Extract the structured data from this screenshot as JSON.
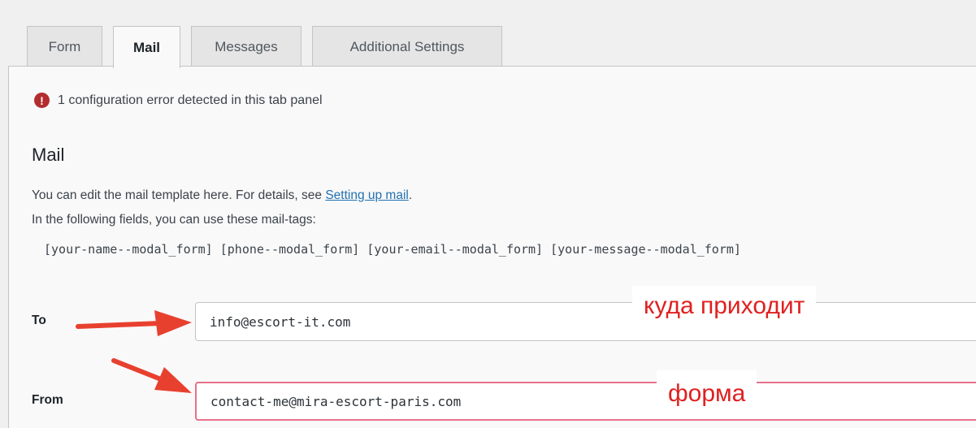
{
  "tabs": [
    {
      "label": "Form",
      "active": false
    },
    {
      "label": "Mail",
      "active": true
    },
    {
      "label": "Messages",
      "active": false
    },
    {
      "label": "Additional Settings",
      "active": false
    }
  ],
  "error": {
    "icon": "!",
    "text": "1 configuration error detected in this tab panel"
  },
  "mail": {
    "heading": "Mail",
    "desc_line1_prefix": "You can edit the mail template here. For details, see ",
    "desc_link": "Setting up mail",
    "desc_line1_suffix": ".",
    "desc_line2": "In the following fields, you can use these mail-tags:",
    "mail_tags": "[your-name--modal_form] [phone--modal_form] [your-email--modal_form] [your-message--modal_form]"
  },
  "fields": {
    "to": {
      "label": "To",
      "value": "info@escort-it.com"
    },
    "from": {
      "label": "From",
      "value": "contact-me@mira-escort-paris.com"
    }
  },
  "annotations": {
    "to_note": "куда приходит",
    "from_note": "форма",
    "arrow_color": "#e8402f"
  }
}
